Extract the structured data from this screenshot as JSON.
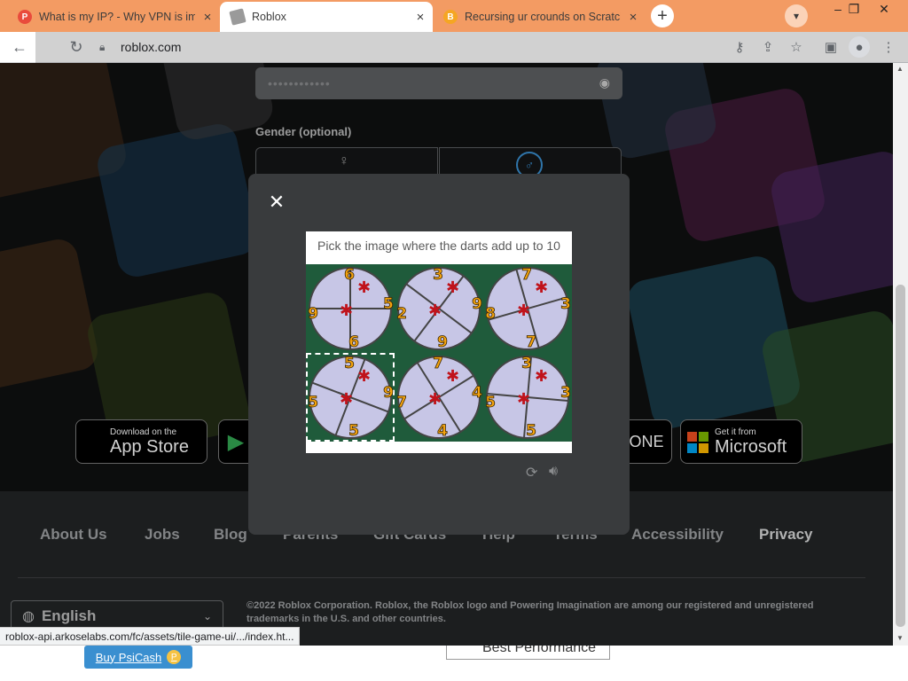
{
  "browser": {
    "tabs": [
      {
        "title": "What is my IP? - Why VPN is imp",
        "favicon": "P",
        "color": "#e94b3c",
        "active": false
      },
      {
        "title": "Roblox",
        "favicon": "R",
        "color": "#7a7a7a",
        "active": true
      },
      {
        "title": "Recursing ur crounds on Scratch",
        "favicon": "B",
        "color": "#f5a623",
        "active": false
      }
    ],
    "tab_close": "×",
    "new_tab": "+",
    "tab_search_icon": "chevron-down-icon",
    "window_controls": [
      "–",
      "❐",
      "✕"
    ],
    "url": "roblox.com",
    "toolbar_icons": [
      "key-icon",
      "share-icon",
      "star-icon",
      "sidebar-icon",
      "profile-icon",
      "kebab-menu-icon"
    ]
  },
  "signup": {
    "password_mask": "••••••••••••",
    "gender_label": "Gender (optional)"
  },
  "captcha": {
    "prompt": "Pick the image where the darts add up to 10",
    "close": "✕",
    "reload_icon": "reload-icon",
    "audio_icon": "audio-icon",
    "cells": [
      {
        "numbers": [
          "6",
          "5",
          "9",
          "6"
        ],
        "selected": false
      },
      {
        "numbers": [
          "3",
          "9",
          "2",
          "9"
        ],
        "selected": false
      },
      {
        "numbers": [
          "7",
          "3",
          "8",
          "7"
        ],
        "selected": false
      },
      {
        "numbers": [
          "5",
          "9",
          "5",
          "5"
        ],
        "selected": true
      },
      {
        "numbers": [
          "7",
          "4",
          "7",
          "4"
        ],
        "selected": false
      },
      {
        "numbers": [
          "3",
          "3",
          "5",
          "5"
        ],
        "selected": false
      }
    ]
  },
  "stores": {
    "apple": {
      "line1": "Download on the",
      "line2": "App Store"
    },
    "ms_partial": "ONE",
    "microsoft": {
      "line1": "Get it from",
      "line2": "Microsoft"
    }
  },
  "footer": {
    "links": [
      "About Us",
      "Jobs",
      "Blog",
      "Parents",
      "Gift Cards",
      "Help",
      "Terms",
      "Accessibility",
      "Privacy"
    ],
    "language": "English",
    "copyright": "©2022 Roblox Corporation. Roblox, the Roblox logo and Powering Imagination are among our registered and unregistered trademarks in the U.S. and other countries."
  },
  "status_url": "roblox-api.arkoselabs.com/fc/assets/tile-game-ui/.../index.ht...",
  "bottom_ad": {
    "buy_label": "Buy PsiCash",
    "best_label": "Best Performance"
  }
}
